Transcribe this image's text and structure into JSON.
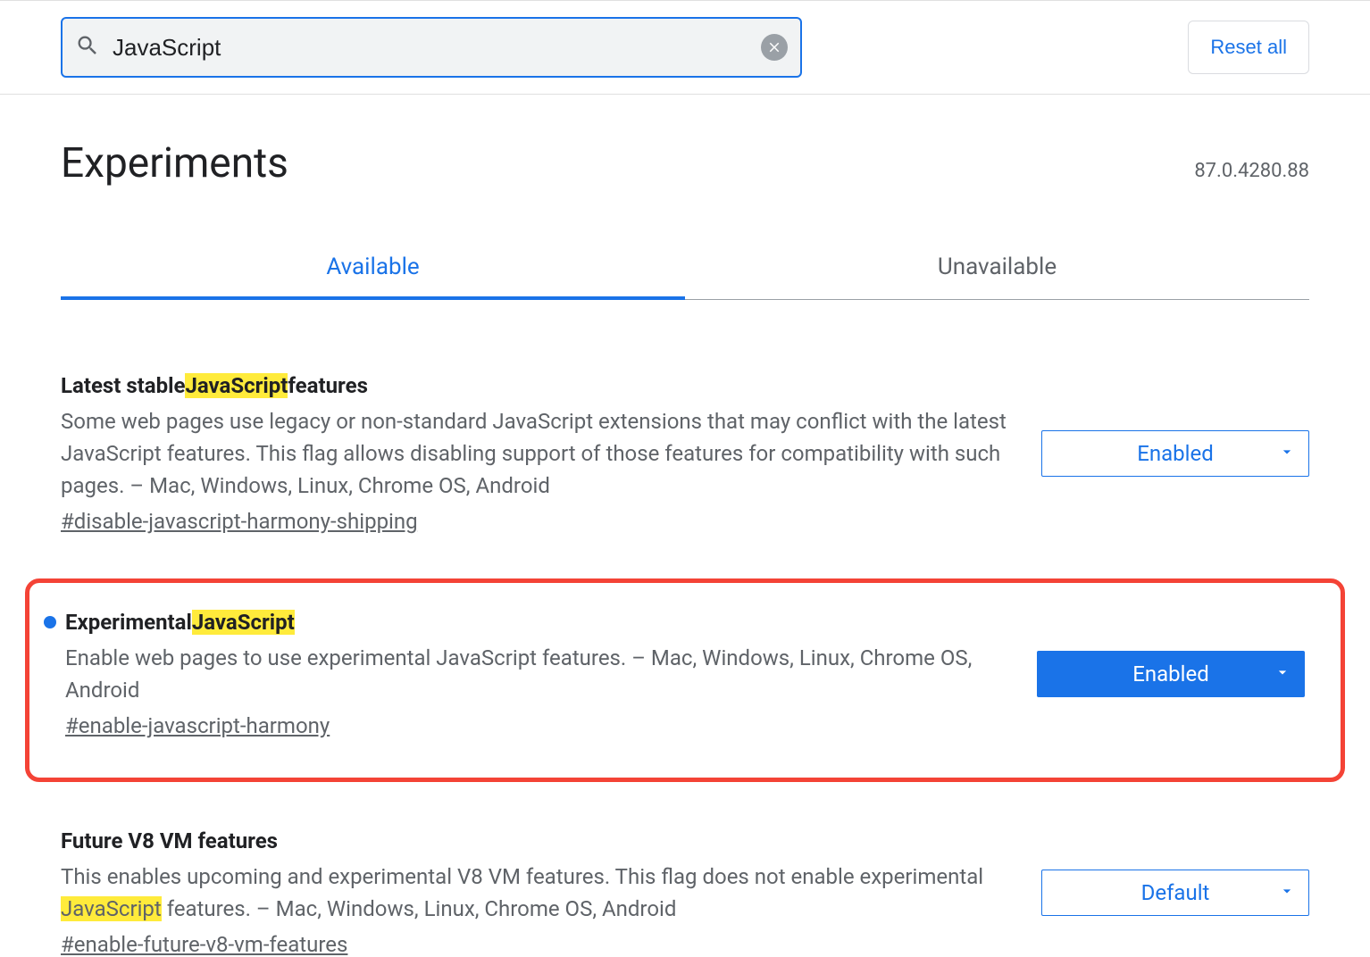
{
  "search": {
    "value": "JavaScript"
  },
  "reset_label": "Reset all",
  "page_title": "Experiments",
  "version": "87.0.4280.88",
  "tabs": {
    "available": "Available",
    "unavailable": "Unavailable"
  },
  "highlight_term": "JavaScript",
  "flags": [
    {
      "title_pre": "Latest stable ",
      "title_hl": "JavaScript",
      "title_post": " features",
      "desc": "Some web pages use legacy or non-standard JavaScript extensions that may conflict with the latest JavaScript features. This flag allows disabling support of those features for compatibility with such pages. – Mac, Windows, Linux, Chrome OS, Android",
      "link": "#disable-javascript-harmony-shipping",
      "select_value": "Enabled",
      "select_filled": false,
      "dot": false,
      "boxed": false
    },
    {
      "title_pre": "Experimental ",
      "title_hl": "JavaScript",
      "title_post": "",
      "desc": "Enable web pages to use experimental JavaScript features. – Mac, Windows, Linux, Chrome OS, Android",
      "link": "#enable-javascript-harmony",
      "select_value": "Enabled",
      "select_filled": true,
      "dot": true,
      "boxed": true
    },
    {
      "title_pre": "Future V8 VM features",
      "title_hl": "",
      "title_post": "",
      "desc_pre": "This enables upcoming and experimental V8 VM features. This flag does not enable experimental ",
      "desc_hl": "JavaScript",
      "desc_post": " features. – Mac, Windows, Linux, Chrome OS, Android",
      "link": "#enable-future-v8-vm-features",
      "select_value": "Default",
      "select_filled": false,
      "dot": false,
      "boxed": false
    }
  ]
}
